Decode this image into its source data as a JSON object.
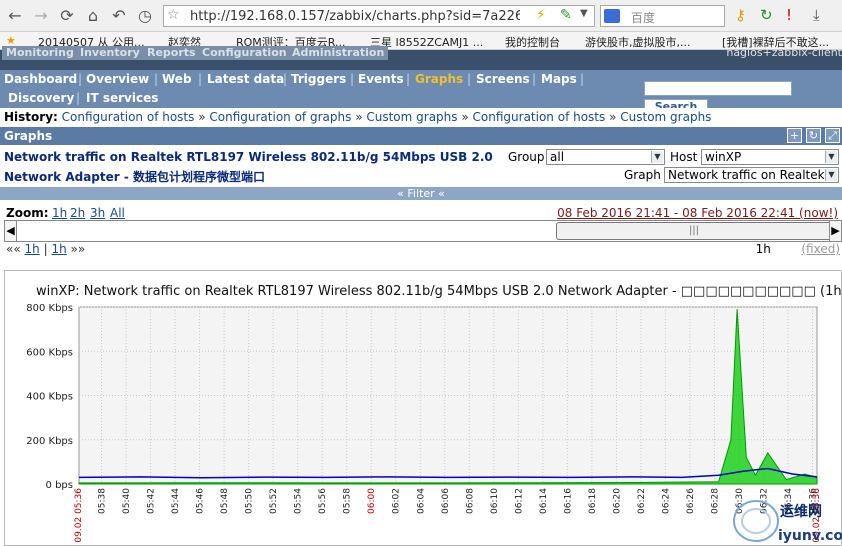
{
  "browser": {
    "url": "http://192.168.0.157/zabbix/charts.php?sid=7a226ce160c",
    "search_placeholder": "百度",
    "bookmarks": [
      "20140507 从 公用...",
      "赵奕然",
      "ROM测评：百度云R...",
      "三星 I8552ZCAMJ1 ...",
      "我的控制台",
      "游侠股市,虚拟股市,...",
      "[我槽]裸辞后不敢这..."
    ]
  },
  "zabbix": {
    "top_tabs": [
      "Monitoring",
      "Inventory",
      "Reports",
      "Configuration",
      "Administration"
    ],
    "hostname": "nagios+zabbix-client",
    "menu": [
      "Dashboard",
      "Overview",
      "Web",
      "Latest data",
      "Triggers",
      "Events",
      "Graphs",
      "Screens",
      "Maps",
      "Discovery",
      "IT services"
    ],
    "active_menu": "Graphs",
    "search_button": "Search",
    "history_label": "History:",
    "history": [
      "Configuration of hosts",
      "Configuration of graphs",
      "Custom graphs",
      "Configuration of hosts",
      "Custom graphs"
    ],
    "section_title": "Graphs",
    "graph_name_line1": "Network traffic on Realtek RTL8197 Wireless 802.11b/g 54Mbps USB 2.0",
    "graph_name_line2": "Network Adapter - 数据包计划程序微型端口",
    "group_label": "Group",
    "group_value": "all",
    "host_label": "Host",
    "host_value": "winXP",
    "graph_label": "Graph",
    "graph_value": "Network traffic on Realtek R",
    "filter_label": "« Filter «",
    "zoom_label": "Zoom:",
    "zoom_options": [
      "1h",
      "2h",
      "3h",
      "All"
    ],
    "period": "08 Feb 2016 21:41  -  08 Feb 2016 22:41 (now!)",
    "nav_left": "«« 1h | 1h »»",
    "nav_1h_a": "1h",
    "nav_1h_b": "1h",
    "nav_right_period": "1h",
    "fixed_label": "(fixed)",
    "scroll_thumb": "|||"
  },
  "chart_data": {
    "type": "area",
    "title": "winXP: Network traffic on Realtek RTL8197 Wireless 802.11b/g 54Mbps USB 2.0 Network Adapter - □□□□□□□□□□□ (1h)",
    "y_ticks": [
      "800 Kbps",
      "600 Kbps",
      "400 Kbps",
      "200 Kbps",
      "0 bps"
    ],
    "ylim": [
      0,
      800
    ],
    "x_start_label": "09.02 05:36",
    "x_end_label": "09.02 06:36",
    "x_ticks": [
      "05:38",
      "05:40",
      "05:42",
      "05:44",
      "05:46",
      "05:48",
      "05:50",
      "05:52",
      "05:54",
      "05:56",
      "05:58",
      "06:00",
      "06:02",
      "06:04",
      "06:06",
      "06:08",
      "06:10",
      "06:12",
      "06:14",
      "06:16",
      "06:18",
      "06:20",
      "06:22",
      "06:24",
      "06:26",
      "06:28",
      "06:30",
      "06:32",
      "06:34",
      "06:36"
    ],
    "highlight_tick": "06:00",
    "series": [
      {
        "color": "#009900",
        "fill": "#00cc00",
        "points": [
          [
            0,
            5
          ],
          [
            8,
            5
          ],
          [
            20,
            6
          ],
          [
            40,
            5
          ],
          [
            60,
            5
          ],
          [
            75,
            6
          ],
          [
            90,
            7
          ],
          [
            104,
            10
          ],
          [
            106,
            200
          ],
          [
            107,
            790
          ],
          [
            108.5,
            120
          ],
          [
            110,
            40
          ],
          [
            112,
            140
          ],
          [
            115,
            20
          ],
          [
            118,
            45
          ],
          [
            120,
            30
          ]
        ]
      },
      {
        "color": "#0000cc",
        "fill": "none",
        "points": [
          [
            0,
            30
          ],
          [
            10,
            32
          ],
          [
            20,
            28
          ],
          [
            30,
            31
          ],
          [
            40,
            30
          ],
          [
            50,
            32
          ],
          [
            60,
            30
          ],
          [
            70,
            31
          ],
          [
            80,
            30
          ],
          [
            90,
            32
          ],
          [
            98,
            30
          ],
          [
            104,
            40
          ],
          [
            108,
            58
          ],
          [
            112,
            70
          ],
          [
            116,
            45
          ],
          [
            120,
            32
          ]
        ]
      }
    ]
  },
  "watermark": {
    "cn": "运维网",
    "text": "iyunv.com"
  }
}
